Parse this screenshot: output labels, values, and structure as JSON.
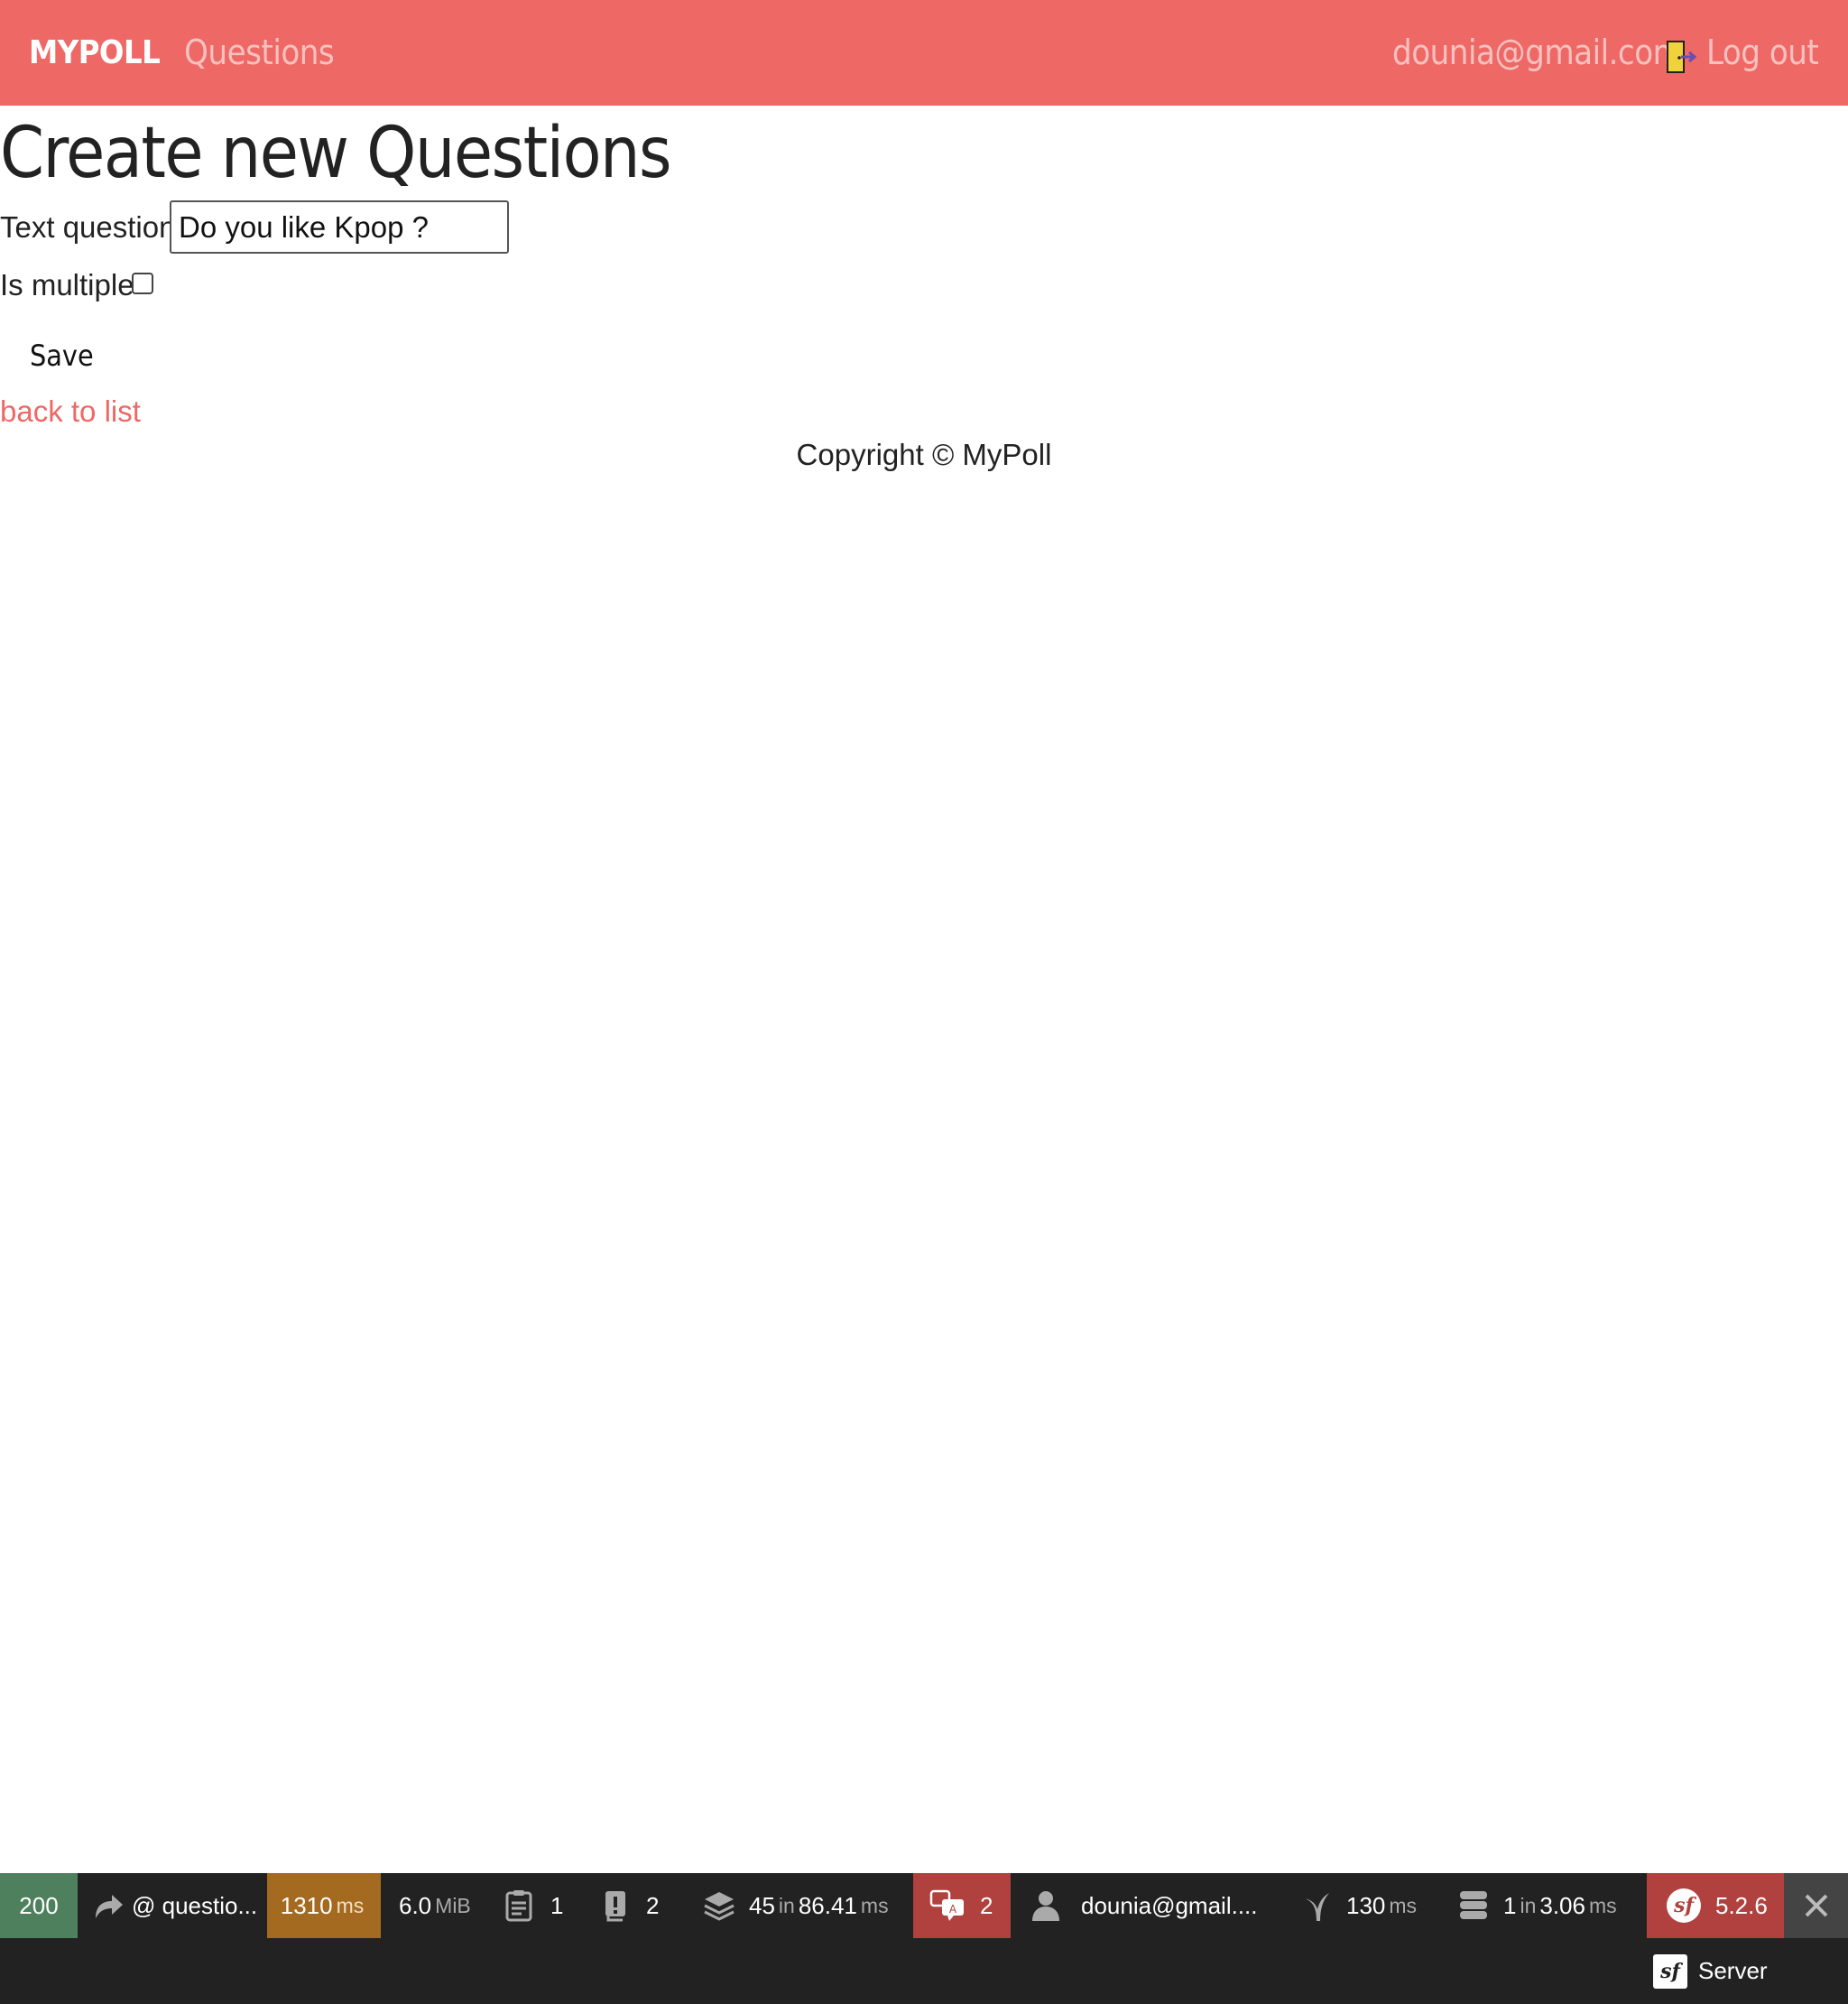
{
  "navbar": {
    "brand": "MYPOLL",
    "questions_link": "Questions",
    "user_email": "dounia@gmail.com",
    "logout_label": "Log out",
    "background_color": "#ee6865"
  },
  "page": {
    "title": "Create new Questions",
    "form": {
      "text_question_label": "Text question",
      "text_question_value": "Do you like Kpop ?",
      "is_multiple_label": "Is multiple",
      "is_multiple_checked": false,
      "save_label": "Save"
    },
    "back_link": "back to list",
    "footer": "Copyright © MyPoll"
  },
  "debug_toolbar": {
    "status_code": "200",
    "status_color": "#4f805d",
    "route": "@ questio...",
    "time": "1310",
    "time_unit": "ms",
    "time_color": "#a46a1f",
    "memory": "6.0",
    "memory_unit": "MiB",
    "logs_count": "1",
    "exceptions_count": "2",
    "events_count": "45",
    "events_in": "in",
    "events_time": "86.41",
    "events_unit": "ms",
    "translation_count": "2",
    "translation_color": "#b0413e",
    "user": "dounia@gmail....",
    "twig_time": "130",
    "twig_unit": "ms",
    "cache_count": "1",
    "cache_in": "in",
    "cache_time": "3.06",
    "cache_unit": "ms",
    "symfony_version": "5.2.6",
    "server_label": "Server",
    "close_icon": "close-icon"
  }
}
